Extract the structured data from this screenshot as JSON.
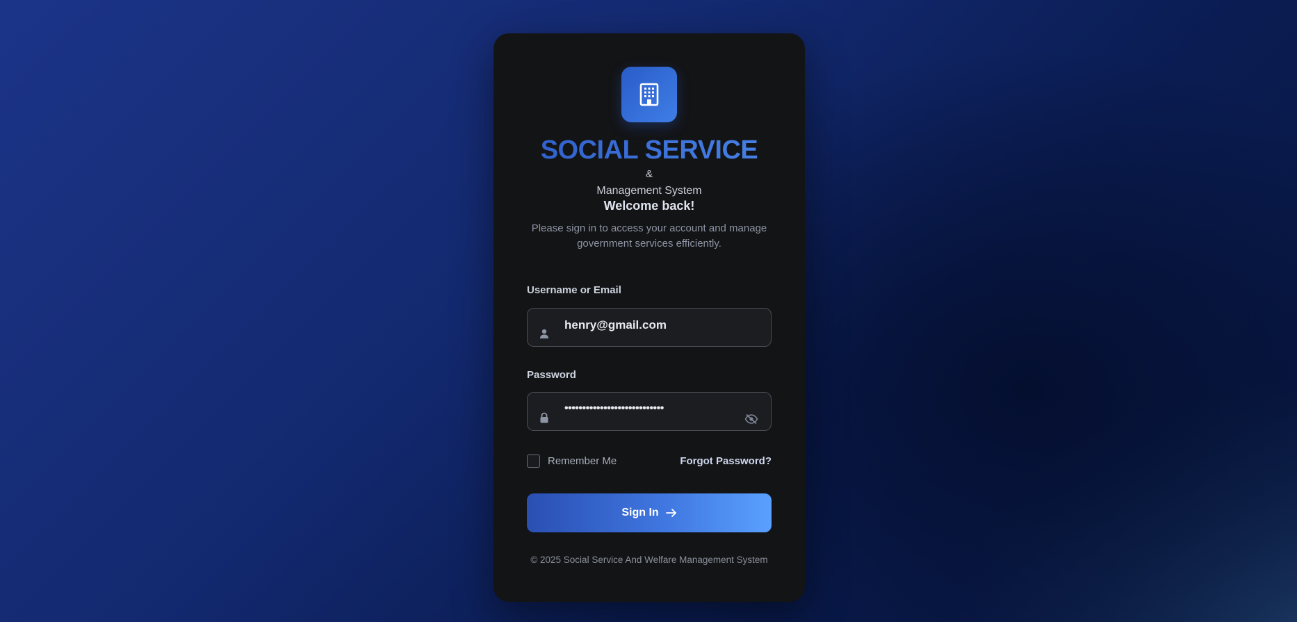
{
  "brand": {
    "logo_icon": "building-icon",
    "title": "SOCIAL SERVICE",
    "ampersand": "&",
    "subtitle": "Management System"
  },
  "intro": {
    "heading": "Welcome back!",
    "description": "Please sign in to access your account and manage government services efficiently."
  },
  "form": {
    "username": {
      "label": "Username or Email",
      "value": "henry@gmail.com",
      "icon": "user-icon"
    },
    "password": {
      "label": "Password",
      "masked_value": "••••••••••••••••••••••••••••",
      "icon": "lock-icon",
      "toggle_icon": "eye-off-icon"
    },
    "remember_label": "Remember Me",
    "remember_checked": false,
    "forgot_label": "Forgot Password?",
    "submit_label": "Sign In",
    "submit_icon": "arrow-right-icon"
  },
  "footer": {
    "copyright": "© 2025 Social Service And Welfare Management System"
  },
  "colors": {
    "accent": "#3a6fd8",
    "card": "#131416",
    "button_start": "#2a4fb3",
    "button_end": "#5aa0ff"
  }
}
